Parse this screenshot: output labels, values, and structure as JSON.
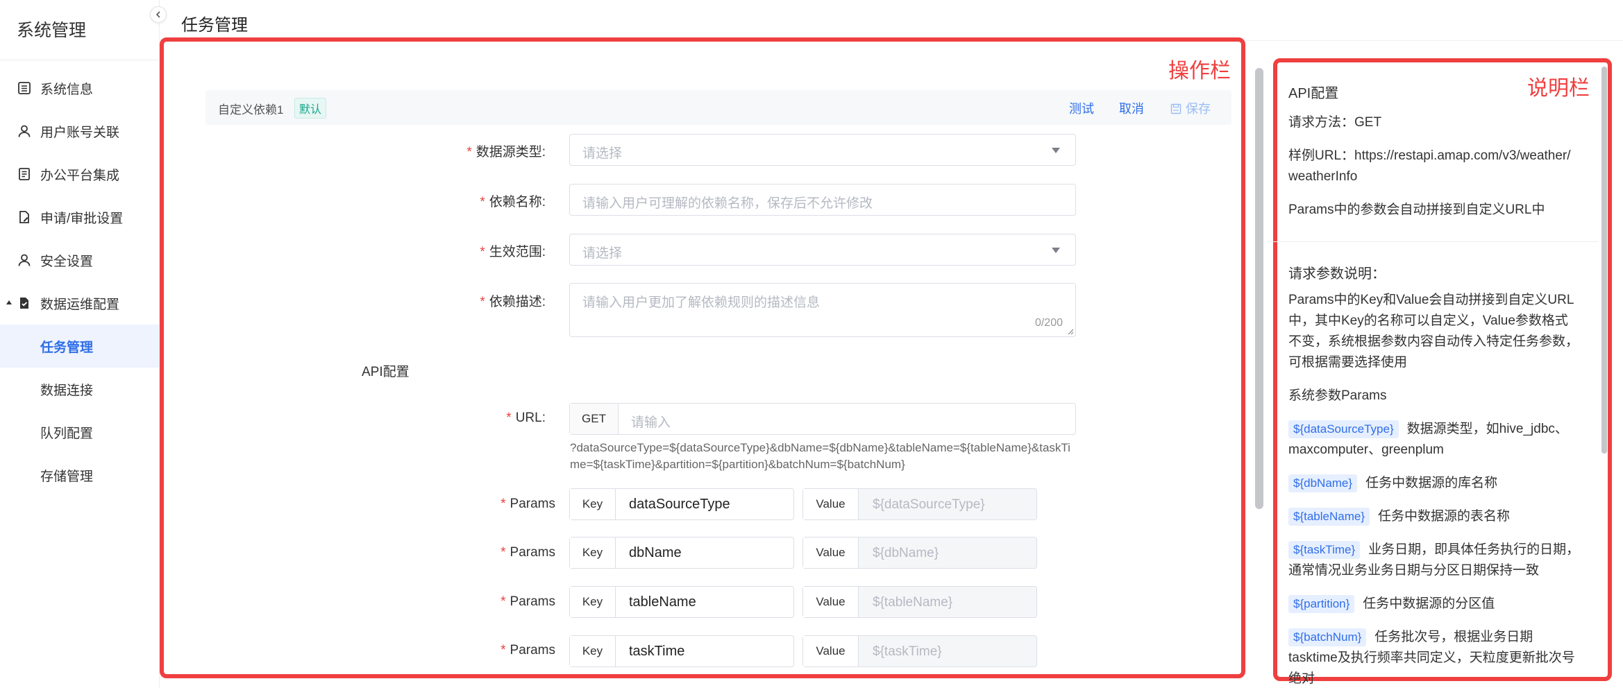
{
  "sidebar": {
    "title": "系统管理",
    "items": [
      {
        "label": "系统信息",
        "icon": "list-icon"
      },
      {
        "label": "用户账号关联",
        "icon": "user-icon"
      },
      {
        "label": "办公平台集成",
        "icon": "doc-icon"
      },
      {
        "label": "申请/审批设置",
        "icon": "file-edit-icon"
      },
      {
        "label": "安全设置",
        "icon": "user-icon"
      },
      {
        "label": "数据运维配置",
        "icon": "file-check-icon"
      }
    ],
    "sub_items": [
      {
        "label": "任务管理",
        "active": true
      },
      {
        "label": "数据连接"
      },
      {
        "label": "队列配置"
      },
      {
        "label": "存储管理"
      }
    ]
  },
  "header": {
    "title": "任务管理"
  },
  "annotations": {
    "operation": "操作栏",
    "description": "说明栏"
  },
  "card": {
    "name": "自定义依赖1",
    "badge": "默认",
    "actions": {
      "test": "测试",
      "cancel": "取消",
      "save": "保存"
    }
  },
  "form": {
    "datasource": {
      "label": "数据源类型:",
      "placeholder": "请选择"
    },
    "dep_name": {
      "label": "依赖名称:",
      "placeholder": "请输入用户可理解的依赖名称，保存后不允许修改"
    },
    "scope": {
      "label": "生效范围:",
      "placeholder": "请选择"
    },
    "desc": {
      "label": "依赖描述:",
      "placeholder": "请输入用户更加了解依赖规则的描述信息",
      "counter": "0/200"
    },
    "api_section": "API配置",
    "url": {
      "label": "URL:",
      "method": "GET",
      "placeholder": "请输入",
      "hint": "?dataSourceType=${dataSourceType}&dbName=${dbName}&tableName=${tableName}&taskTime=${taskTime}&partition=${partition}&batchNum=${batchNum}"
    },
    "params_label": "Params",
    "key_tag": "Key",
    "value_tag": "Value",
    "params": [
      {
        "key": "dataSourceType",
        "value": "${dataSourceType}"
      },
      {
        "key": "dbName",
        "value": "${dbName}"
      },
      {
        "key": "tableName",
        "value": "${tableName}"
      },
      {
        "key": "taskTime",
        "value": "${taskTime}"
      }
    ]
  },
  "side": {
    "api_title": "API配置",
    "method": "请求方法：GET",
    "sample_url": "样例URL：https://restapi.amap.com/v3/weather/weatherInfo",
    "params_note": "Params中的参数会自动拼接到自定义URL中",
    "req_title": "请求参数说明：",
    "req_desc": "Params中的Key和Value会自动拼接到自定义URL中，其中Key的名称可以自定义，Value参数格式不变，系统根据参数内容自动传入特定任务参数，可根据需要选择使用",
    "sys_params_title": "系统参数Params",
    "sys_params": [
      {
        "tag": "${dataSourceType}",
        "desc": "数据源类型，如hive_jdbc、maxcomputer、greenplum"
      },
      {
        "tag": "${dbName}",
        "desc": "任务中数据源的库名称"
      },
      {
        "tag": "${tableName}",
        "desc": "任务中数据源的表名称"
      },
      {
        "tag": "${taskTime}",
        "desc": "业务日期，即具体任务执行的日期，通常情况业务业务日期与分区日期保持一致"
      },
      {
        "tag": "${partition}",
        "desc": "任务中数据源的分区值"
      },
      {
        "tag": "${batchNum}",
        "desc": "任务批次号，根据业务日期tasktime及执行频率共同定义，天粒度更新批次号绝对"
      }
    ]
  },
  "colors": {
    "accent": "#2f6ee8",
    "annotation": "#ef3f3f",
    "required": "#ef3f3f"
  }
}
